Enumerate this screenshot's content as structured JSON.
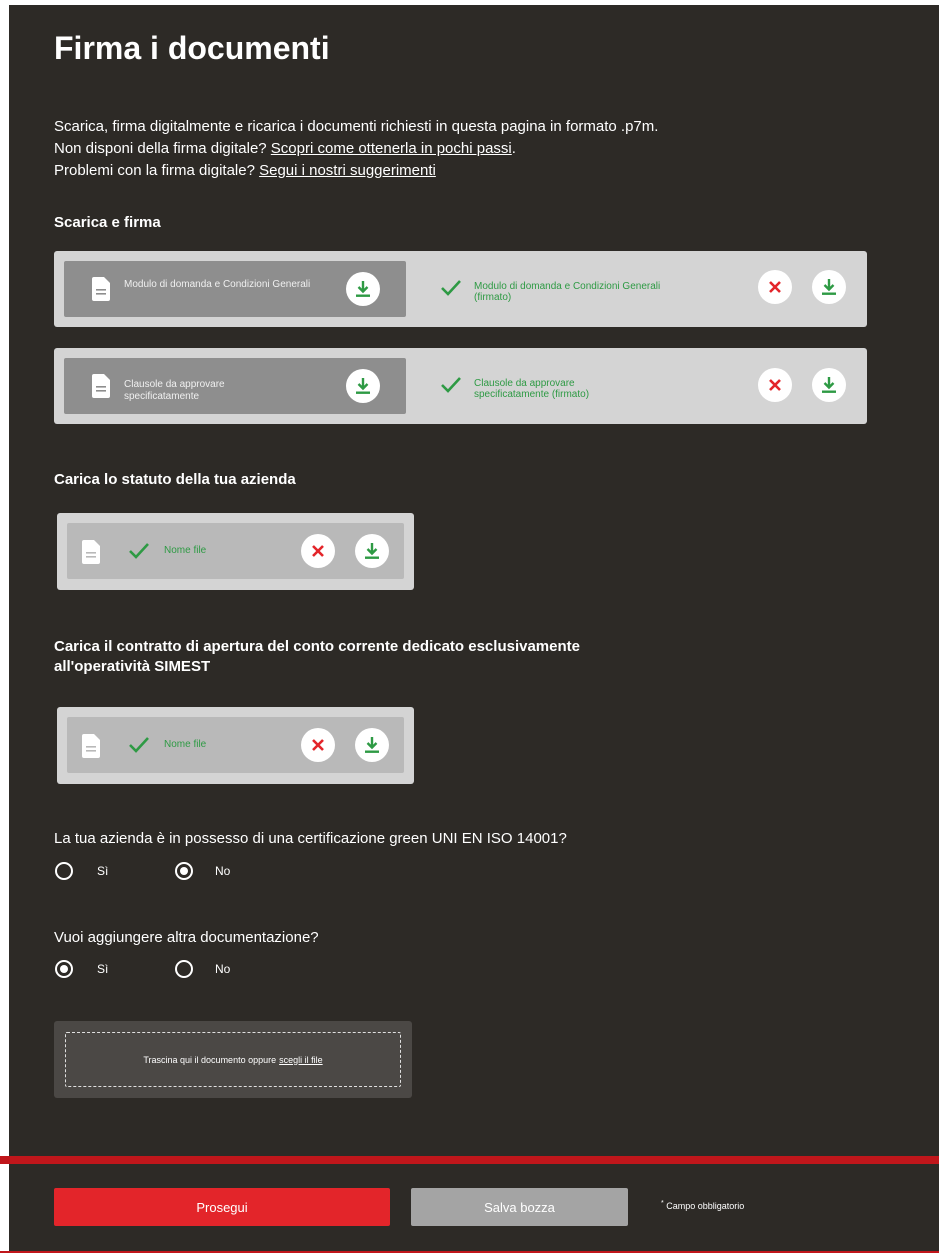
{
  "title": "Firma i documenti",
  "intro": {
    "line1": "Scarica, firma digitalmente e ricarica i documenti richiesti in questa pagina in formato .p7m.",
    "line2_text": "Non disponi della firma digitale? ",
    "line2_link": "Scopri come ottenerla in pochi passi",
    "line2_end": ".",
    "line3_text": "Problemi con la firma digitale? ",
    "line3_link": "Segui i nostri suggerimenti"
  },
  "sign_section": {
    "title": "Scarica e firma",
    "rows": [
      {
        "document": "Modulo di domanda e Condizioni Generali",
        "signed": "Modulo di domanda e Condizioni Generali (firmato)"
      },
      {
        "document": "Clausole da approvare specificatamente",
        "signed": "Clausole da approvare specificatamente (firmato)"
      }
    ]
  },
  "statuto": {
    "title": "Carica lo statuto della tua azienda",
    "file_name": "Nome file"
  },
  "contratto": {
    "title_line1": "Carica il contratto di apertura del conto corrente dedicato esclusivamente",
    "title_line2": "all'operatività SIMEST",
    "file_name": "Nome file"
  },
  "green_cert": {
    "question": "La tua azienda è in possesso di una certificazione green UNI EN ISO 14001?",
    "options": [
      "Sì",
      "No"
    ],
    "selected": "No"
  },
  "extra_docs": {
    "question": "Vuoi aggiungere altra documentazione?",
    "options": [
      "Sì",
      "No"
    ],
    "selected": "Sì"
  },
  "dropzone": {
    "text": "Trascina qui il documento oppure",
    "link": "scegli il file"
  },
  "footer": {
    "primary": "Prosegui",
    "secondary": "Salva bozza",
    "required_mark": "*",
    "required_note": "Campo obbligatorio"
  },
  "colors": {
    "panel": "#2d2a26",
    "accent_red": "#e3252a",
    "success_green": "#2e9a44",
    "error_red": "#e3252a"
  }
}
